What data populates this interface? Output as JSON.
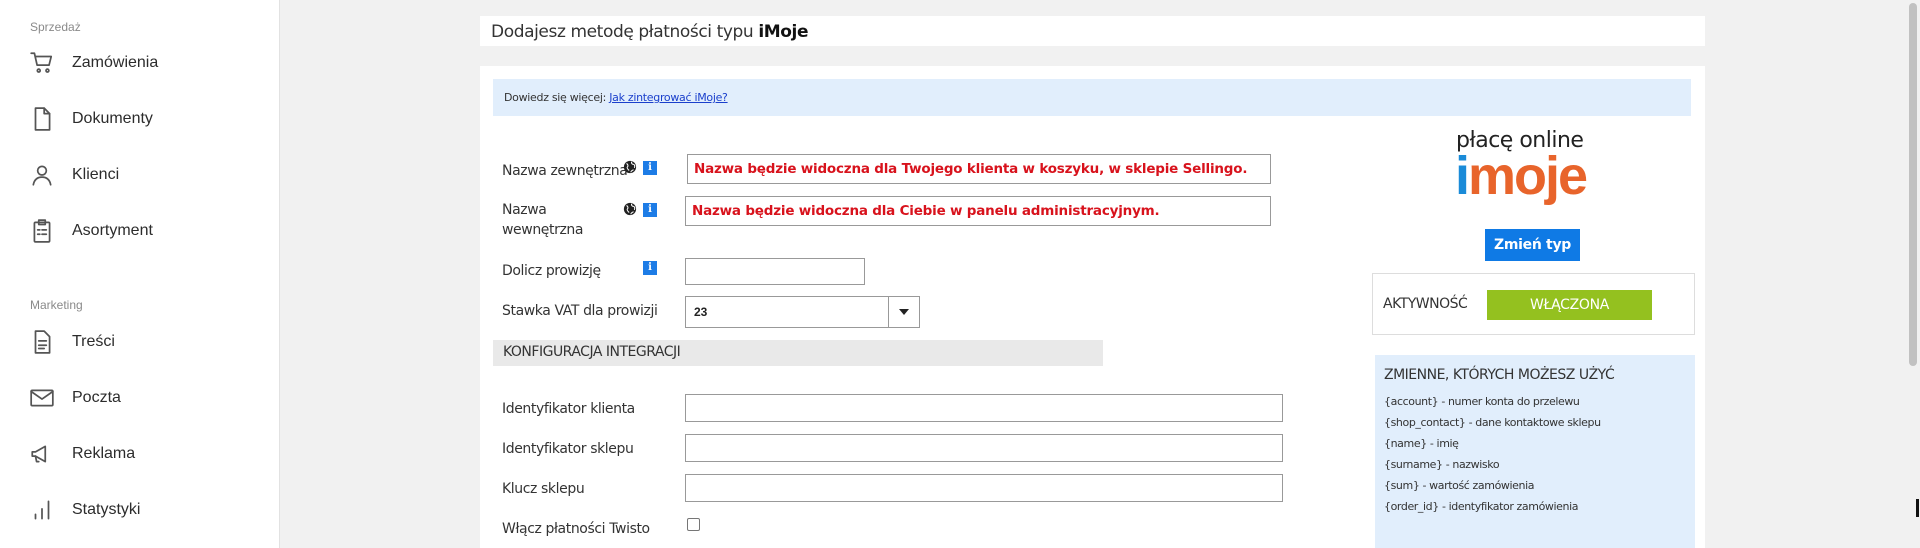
{
  "sidebar": {
    "sections": [
      {
        "label": "Sprzedaż"
      },
      {
        "label": "Marketing"
      }
    ],
    "items": [
      {
        "label": "Zamówienia",
        "icon": "cart-icon"
      },
      {
        "label": "Dokumenty",
        "icon": "document-icon"
      },
      {
        "label": "Klienci",
        "icon": "user-icon"
      },
      {
        "label": "Asortyment",
        "icon": "clipboard-icon"
      },
      {
        "label": "Treści",
        "icon": "content-icon"
      },
      {
        "label": "Poczta",
        "icon": "mail-icon"
      },
      {
        "label": "Reklama",
        "icon": "megaphone-icon"
      },
      {
        "label": "Statystyki",
        "icon": "chart-icon"
      }
    ]
  },
  "header": {
    "prefix": "Dodajesz metodę płatności typu",
    "type": "iMoje"
  },
  "info": {
    "text": "Dowiedz się więcej:",
    "link": "Jak zintegrować iMoje?"
  },
  "form": {
    "external_name_label": "Nazwa zewnętrzna",
    "external_name_value": "Nazwa będzie widoczna dla Twojego klienta w koszyku, w sklepie Sellingo.",
    "internal_name_label_1": "Nazwa",
    "internal_name_label_2": "wewnętrzna",
    "internal_name_value": "Nazwa będzie widoczna dla Ciebie w panelu administracyjnym.",
    "commission_label": "Dolicz prowizję",
    "commission_value": "",
    "vat_label": "Stawka VAT dla prowizji",
    "vat_value": "23",
    "section_title": "KONFIGURACJA INTEGRACJI",
    "client_id_label": "Identyfikator klienta",
    "shop_id_label": "Identyfikator sklepu",
    "shop_key_label": "Klucz sklepu",
    "twisto_label": "Włącz płatności Twisto",
    "info_badge": "i"
  },
  "logo": {
    "top": "płacę online",
    "i": "i",
    "rest": "moje"
  },
  "change_type_label": "Zmień typ",
  "active": {
    "label": "AKTYWNOŚĆ",
    "state": "WŁĄCZONA"
  },
  "variables": {
    "title": "ZMIENNE, KTÓRYCH MOŻESZ UŻYĆ",
    "items": [
      "{account} - numer konta do przelewu",
      "{shop_contact} - dane kontaktowe sklepu",
      "{name} - imię",
      "{surname} - nazwisko",
      "{sum} - wartość zamówienia",
      "{order_id} - identyfikator zamówienia"
    ]
  },
  "colors": {
    "accent_blue": "#0f7ae5",
    "active_green": "#94c11f",
    "warning_red": "#d8121c",
    "info_bg": "#e1eefc"
  }
}
